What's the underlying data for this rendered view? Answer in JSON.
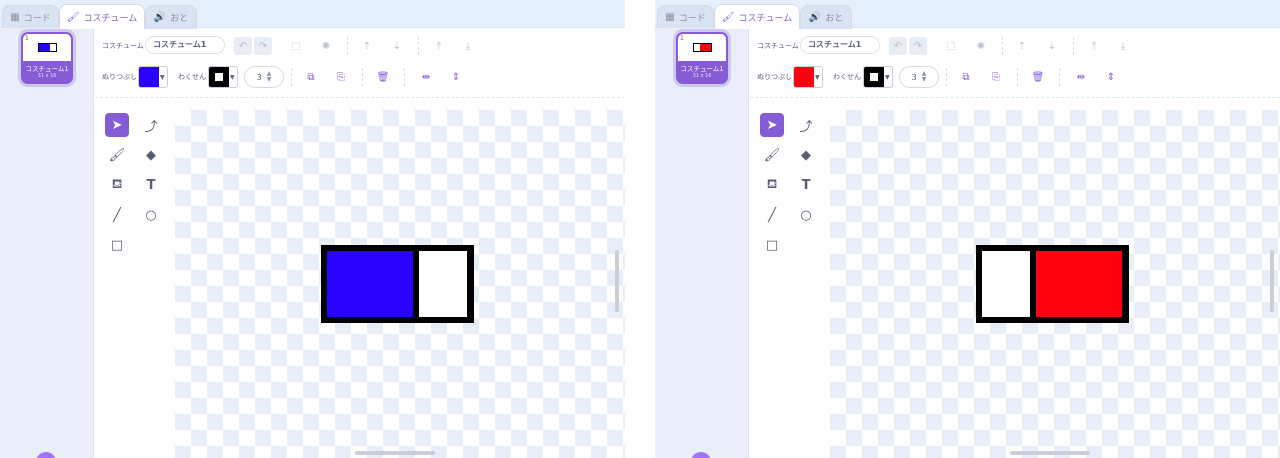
{
  "tabs": {
    "code": "コード",
    "costume": "コスチューム",
    "sound": "おと"
  },
  "costume_list": {
    "index": "1",
    "name": "コスチューム1",
    "size": "31 x 16"
  },
  "toolbar": {
    "costume_label": "コスチューム",
    "costume_name": "コスチューム1",
    "fill_label": "ぬりつぶし",
    "outline_label": "わくせん",
    "outline_width": "3"
  },
  "icons": {
    "code_tab": "blocks-icon",
    "costume_tab": "brush-icon",
    "sound_tab": "speaker-icon",
    "undo": "undo-icon",
    "redo": "redo-icon",
    "group": "group-icon",
    "ungroup": "ungroup-icon",
    "forward": "forward-icon",
    "backward": "backward-icon",
    "front": "front-icon",
    "back": "back-icon",
    "copy": "copy-icon",
    "paste": "paste-icon",
    "delete": "trash-icon",
    "flip_h": "flip-horizontal-icon",
    "flip_v": "flip-vertical-icon"
  },
  "tools": [
    "select",
    "reshape",
    "brush",
    "eraser",
    "fill",
    "text",
    "line",
    "circle",
    "rectangle"
  ],
  "panels": [
    {
      "fill_color": "#2a00ff",
      "outline_color": "#000000",
      "cells": [
        {
          "color": "#2a00ff",
          "weight": 86
        },
        {
          "color": "#ffffff",
          "weight": 48
        }
      ]
    },
    {
      "fill_color": "#ff0011",
      "outline_color": "#000000",
      "cells": [
        {
          "color": "#ffffff",
          "weight": 48
        },
        {
          "color": "#ff0011",
          "weight": 86
        }
      ]
    }
  ]
}
